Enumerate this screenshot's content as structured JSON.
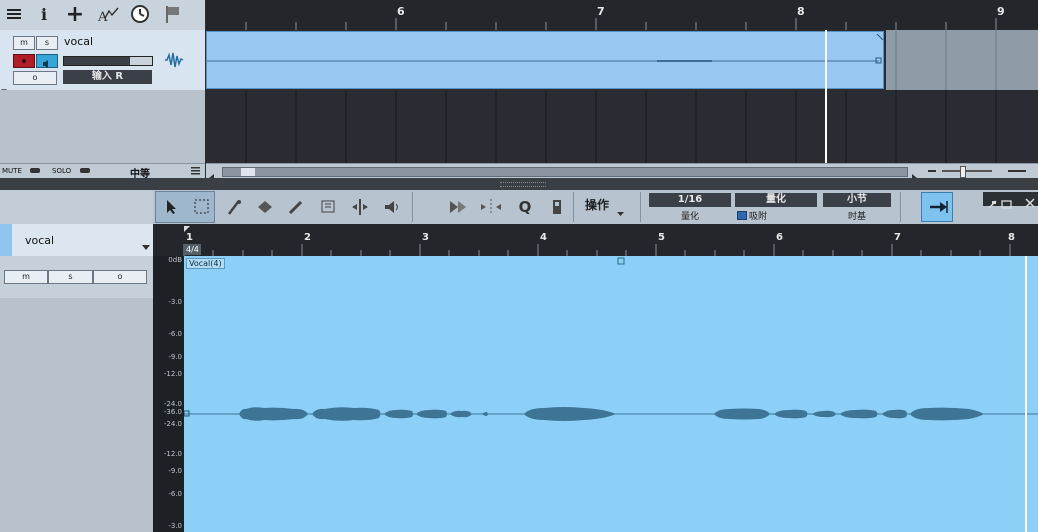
{
  "top_toolbar": {
    "icons": [
      "menu-icon",
      "info-icon",
      "add-icon",
      "automation-icon",
      "clock-icon",
      "flag-icon"
    ]
  },
  "track": {
    "mute": "m",
    "solo": "s",
    "name": "vocal",
    "monitor_o": "o",
    "input": "输入 R"
  },
  "mute_bar": {
    "mute": "MUTE",
    "solo": "SOLO",
    "zoom": "中等"
  },
  "top_ruler": {
    "bars": [
      "6",
      "7",
      "8",
      "9"
    ]
  },
  "editor": {
    "track_name": "vocal",
    "m": "m",
    "s": "s",
    "o": "o",
    "action_menu": "操作",
    "quantize_value": "1/16",
    "quantize_label": "量化",
    "quantize_btn": "量化",
    "snap_label": "吸附",
    "timebase_value": "小节",
    "timebase_label": "时基",
    "time_sig": "4/4",
    "event_name": "Vocal(4)",
    "ruler": [
      "1",
      "2",
      "3",
      "4",
      "5",
      "6",
      "7",
      "8"
    ],
    "db_scale": [
      "0dB",
      "-3.0",
      "-6.0",
      "-9.0",
      "-12.0",
      "-24.0",
      "-36.0",
      "-24.0",
      "-12.0",
      "-9.0",
      "-6.0",
      "-3.0"
    ]
  },
  "colors": {
    "event_blue": "#98c8f2",
    "wave_bg": "#8cd0f8",
    "wave": "#3e7596",
    "record": "#c0202b",
    "monitor": "#36a6d6"
  }
}
